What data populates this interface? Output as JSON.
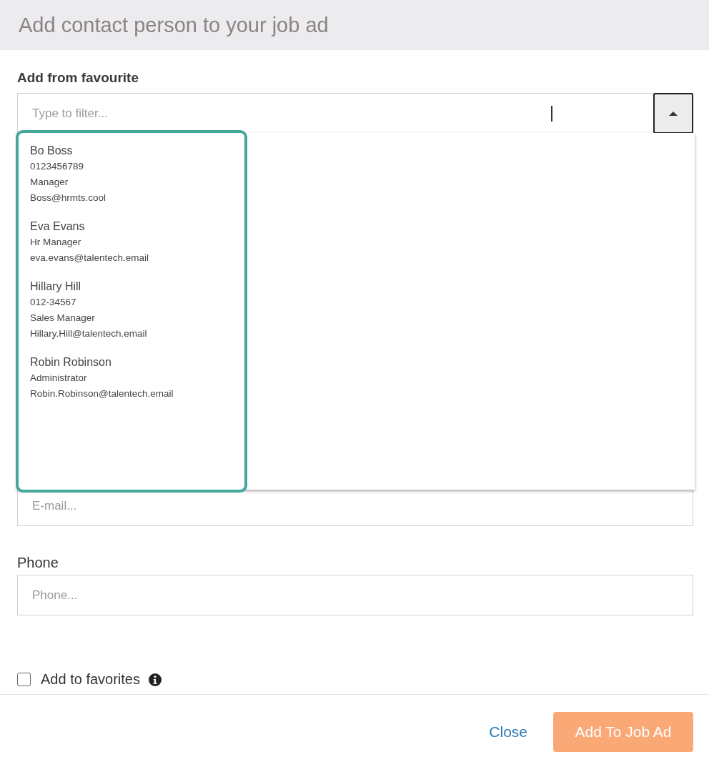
{
  "dialog": {
    "title": "Add contact person to your job ad"
  },
  "favourite": {
    "label": "Add from favourite",
    "placeholder": "Type to filter...",
    "expanded": true,
    "highlighted": true,
    "contacts": [
      {
        "name": "Bo Boss",
        "details": [
          "0123456789",
          "Manager",
          "Boss@hrmts.cool"
        ]
      },
      {
        "name": "Eva Evans",
        "details": [
          "Hr Manager",
          "eva.evans@talentech.email"
        ]
      },
      {
        "name": "Hillary Hill",
        "details": [
          "012-34567",
          "Sales Manager",
          "Hillary.Hill@talentech.email"
        ]
      },
      {
        "name": "Robin Robinson",
        "details": [
          "Administrator",
          "Robin.Robinson@talentech.email"
        ]
      }
    ]
  },
  "email": {
    "placeholder": "E-mail..."
  },
  "phone": {
    "label": "Phone",
    "placeholder": "Phone..."
  },
  "add_to_favorites": {
    "label": "Add to favorites",
    "checked": false
  },
  "buttons": [
    {
      "kind": "link",
      "label": "Close",
      "disabled": false
    },
    {
      "kind": "primary",
      "label": "Add To Job Ad",
      "disabled": true
    }
  ]
}
